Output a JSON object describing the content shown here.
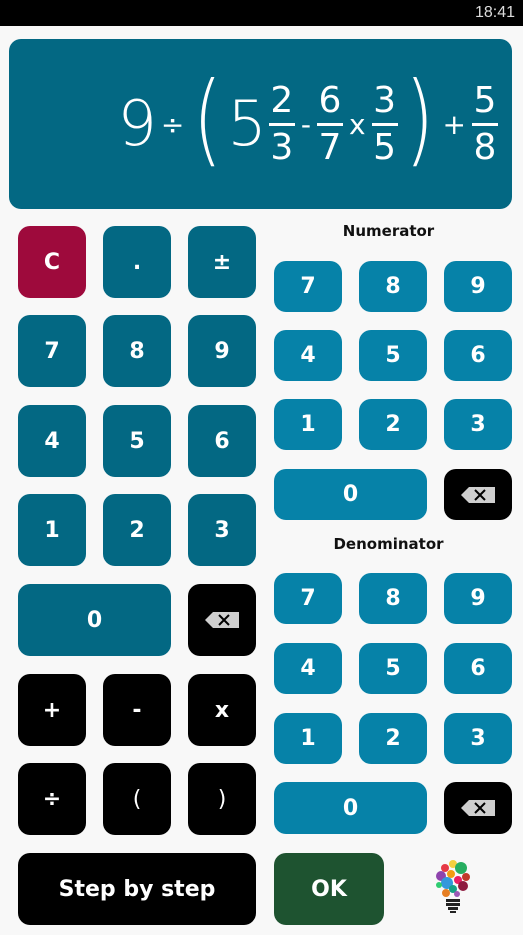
{
  "status_bar": {
    "time": "18:41"
  },
  "display": {
    "expression": {
      "whole": "9",
      "divide": "÷",
      "open_paren": "(",
      "mixed_whole": "5",
      "frac1": {
        "num": "2",
        "den": "3"
      },
      "minus": "-",
      "frac2": {
        "num": "6",
        "den": "7"
      },
      "times": "x",
      "frac3": {
        "num": "3",
        "den": "5"
      },
      "close_paren": ")",
      "plus": "+",
      "frac4": {
        "num": "5",
        "den": "8"
      }
    }
  },
  "main_keypad": {
    "clear": "C",
    "dot": ".",
    "sign": "±",
    "digits": [
      "7",
      "8",
      "9",
      "4",
      "5",
      "6",
      "1",
      "2",
      "3"
    ],
    "zero": "0",
    "backspace_icon": "backspace-icon",
    "plus": "+",
    "minus": "-",
    "times": "x",
    "divide": "÷",
    "open_paren": "(",
    "close_paren": ")",
    "step_by_step": "Step by step"
  },
  "numerator": {
    "label": "Numerator",
    "digits": [
      "7",
      "8",
      "9",
      "4",
      "5",
      "6",
      "1",
      "2",
      "3"
    ],
    "zero": "0",
    "backspace_icon": "backspace-icon"
  },
  "denominator": {
    "label": "Denominator",
    "digits": [
      "7",
      "8",
      "9",
      "4",
      "5",
      "6",
      "1",
      "2",
      "3"
    ],
    "zero": "0",
    "backspace_icon": "backspace-icon"
  },
  "ok": "OK",
  "hint_icon": "lightbulb-icon",
  "colors": {
    "display_bg": "#036883",
    "main_key": "#036883",
    "fraction_key": "#0682a8",
    "clear_key": "#9e0a3c",
    "operator_key": "#000000",
    "ok_key": "#1e5330"
  }
}
